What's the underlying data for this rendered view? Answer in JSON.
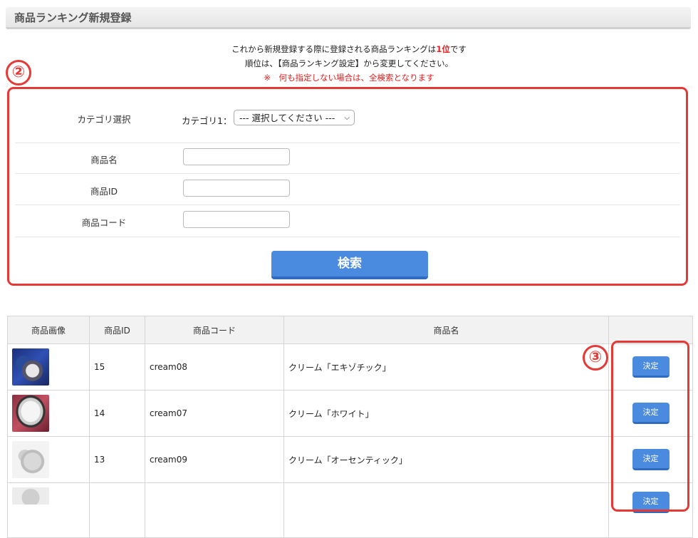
{
  "page_title": "商品ランキング新規登録",
  "notice": {
    "line1_prefix": "これから新規登録する際に登録される商品ランキングは",
    "rank": "1位",
    "line1_suffix": "です",
    "line2": "順位は、【商品ランキング設定】から変更してください。",
    "warning": "※　何も指定しない場合は、全検索となります"
  },
  "markers": {
    "form": "②",
    "decide": "③"
  },
  "form": {
    "category_label": "カテゴリ選択",
    "category1_label": "カテゴリ1：",
    "category_select_value": "--- 選択してください ---",
    "product_name_label": "商品名",
    "product_name_value": "",
    "product_id_label": "商品ID",
    "product_id_value": "",
    "product_code_label": "商品コード",
    "product_code_value": "",
    "search_button": "検索"
  },
  "table": {
    "headers": [
      "商品画像",
      "商品ID",
      "商品コード",
      "商品名",
      ""
    ],
    "rows": [
      {
        "id": "15",
        "code": "cream08",
        "name": "クリーム「エキゾチック」",
        "action": "決定"
      },
      {
        "id": "14",
        "code": "cream07",
        "name": "クリーム「ホワイト」",
        "action": "決定"
      },
      {
        "id": "13",
        "code": "cream09",
        "name": "クリーム「オーセンティック」",
        "action": "決定"
      },
      {
        "id": "",
        "code": "",
        "name": "",
        "action": "決定"
      }
    ]
  },
  "colors": {
    "accent": "#4a8be0",
    "highlight": "#e53935",
    "warning_text": "#e02020"
  }
}
